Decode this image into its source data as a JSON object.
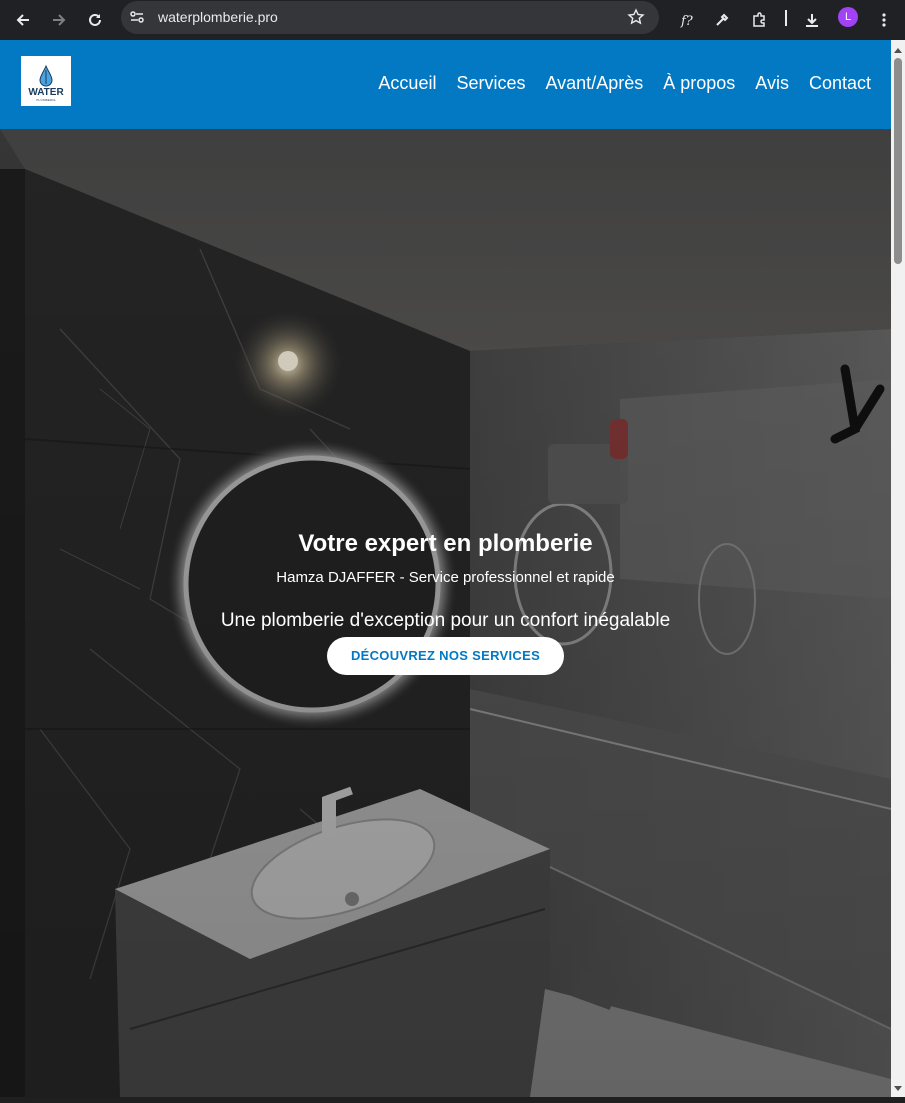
{
  "browser": {
    "url": "waterplomberie.pro",
    "avatar_letter": "L",
    "icons": [
      "back-icon",
      "forward-icon",
      "reload-icon",
      "tune-icon",
      "star-icon",
      "font-icon",
      "eyedropper-icon",
      "extensions-icon",
      "download-icon",
      "menu-icon"
    ]
  },
  "header": {
    "logo_word": "WATER",
    "logo_sub": "PLOMBERIE",
    "nav": [
      {
        "label": "Accueil"
      },
      {
        "label": "Services"
      },
      {
        "label": "Avant/Après"
      },
      {
        "label": "À propos"
      },
      {
        "label": "Avis"
      },
      {
        "label": "Contact"
      }
    ]
  },
  "hero": {
    "title": "Votre expert en plomberie",
    "subtitle": "Hamza DJAFFER - Service professionnel et rapide",
    "tagline": "Une plomberie d'exception pour un confort inégalable",
    "cta_label": "DÉCOUVREZ NOS SERVICES"
  },
  "colors": {
    "brand_blue": "#0379c4",
    "chrome_bg": "#202124",
    "omnibox_bg": "#35363a"
  }
}
